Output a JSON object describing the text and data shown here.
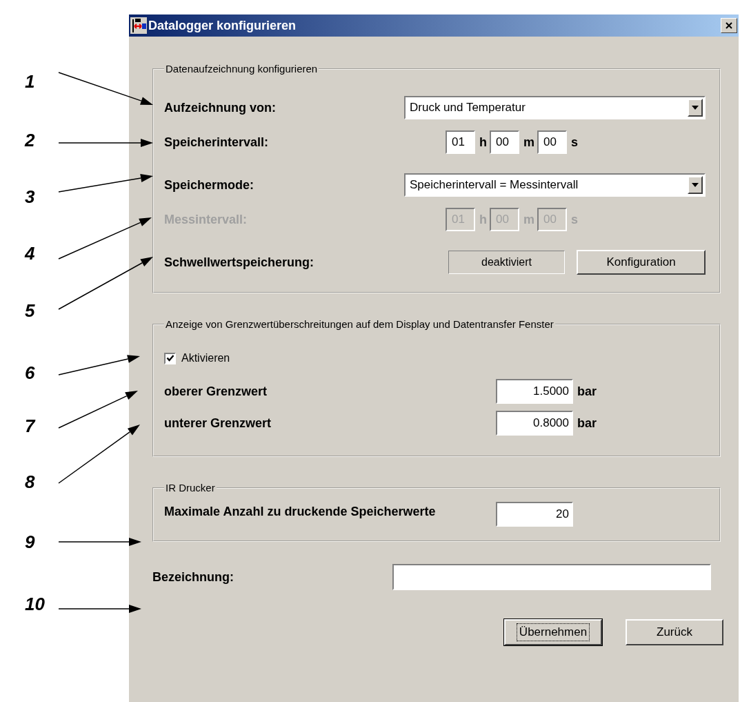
{
  "annotations": [
    {
      "label": "1"
    },
    {
      "label": "2"
    },
    {
      "label": "3"
    },
    {
      "label": "4"
    },
    {
      "label": "5"
    },
    {
      "label": "6"
    },
    {
      "label": "7"
    },
    {
      "label": "8"
    },
    {
      "label": "9"
    },
    {
      "label": "10"
    }
  ],
  "window": {
    "title": "Datalogger konfigurieren"
  },
  "groups": [
    {
      "legend": "Datenaufzeichnung konfigurieren",
      "rows": [
        {
          "kind": "combo",
          "label": "Aufzeichnung von:",
          "value": "Druck und Temperatur"
        },
        {
          "kind": "time",
          "label": "Speicherintervall:",
          "disabled": false,
          "fields": [
            {
              "value": "01",
              "unit": "h"
            },
            {
              "value": "00",
              "unit": "m"
            },
            {
              "value": "00",
              "unit": "s"
            }
          ]
        },
        {
          "kind": "combo",
          "label": "Speichermode:",
          "value": "Speicherintervall = Messintervall"
        },
        {
          "kind": "time",
          "label": "Messintervall:",
          "disabled": true,
          "fields": [
            {
              "value": "01",
              "unit": "h"
            },
            {
              "value": "00",
              "unit": "m"
            },
            {
              "value": "00",
              "unit": "s"
            }
          ]
        },
        {
          "kind": "status",
          "label": "Schwellwertspeicherung:",
          "status": "deaktiviert",
          "button": "Konfiguration"
        }
      ]
    },
    {
      "legend": "Anzeige von Grenzwertüberschreitungen auf dem Display und Datentransfer Fenster",
      "rows": [
        {
          "kind": "checkbox",
          "label": "Aktivieren",
          "checked": true
        },
        {
          "kind": "limit",
          "label": "oberer Grenzwert",
          "value": "1.5000",
          "unit": "bar"
        },
        {
          "kind": "limit",
          "label": "unterer Grenzwert",
          "value": "0.8000",
          "unit": "bar"
        }
      ]
    },
    {
      "legend": "IR Drucker",
      "rows": [
        {
          "kind": "number",
          "label": "Maximale Anzahl zu druckende Speicherwerte",
          "value": "20"
        }
      ]
    }
  ],
  "name_field": {
    "label": "Bezeichnung:"
  },
  "buttons": [
    {
      "label": "Übernehmen",
      "focused": true
    },
    {
      "label": "Zurück",
      "focused": false
    }
  ]
}
